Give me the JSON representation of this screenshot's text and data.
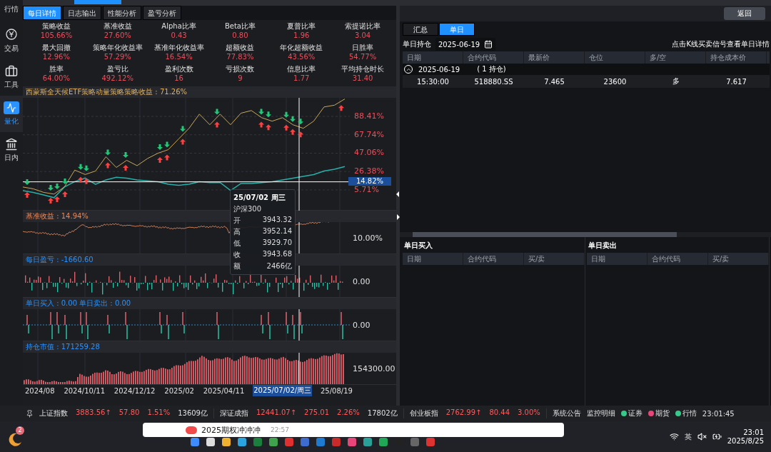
{
  "sidebar": {
    "items": [
      {
        "label": "行情",
        "kind": "cut",
        "selected": false
      },
      {
        "label": "交易",
        "kind": "trade",
        "selected": false
      },
      {
        "label": "工具",
        "kind": "tools",
        "selected": false
      },
      {
        "label": "量化",
        "kind": "quant",
        "selected": true
      },
      {
        "label": "日内",
        "kind": "intraday",
        "selected": false
      }
    ]
  },
  "tabs": [
    {
      "label": "每日详情",
      "selected": true
    },
    {
      "label": "日志输出",
      "selected": false
    },
    {
      "label": "性能分析",
      "selected": false
    },
    {
      "label": "盈亏分析",
      "selected": false
    }
  ],
  "stats": [
    {
      "label": "策略收益",
      "value": "105.66%"
    },
    {
      "label": "基准收益",
      "value": "27.60%"
    },
    {
      "label": "Alpha比率",
      "value": "0.43"
    },
    {
      "label": "Beta比率",
      "value": "0.80"
    },
    {
      "label": "夏普比率",
      "value": "1.96"
    },
    {
      "label": "索提诺比率",
      "value": "3.04"
    },
    {
      "label": "最大回撤",
      "value": "12.96%"
    },
    {
      "label": "策略年化收益率",
      "value": "57.29%"
    },
    {
      "label": "基准年化收益率",
      "value": "16.54%"
    },
    {
      "label": "超额收益",
      "value": "77.83%"
    },
    {
      "label": "年化超额收益",
      "value": "43.56%"
    },
    {
      "label": "日胜率",
      "value": "54.77%"
    },
    {
      "label": "胜率",
      "value": "64.00%"
    },
    {
      "label": "盈亏比",
      "value": "492.12%"
    },
    {
      "label": "盈利次数",
      "value": "16"
    },
    {
      "label": "亏损次数",
      "value": "9"
    },
    {
      "label": "信息比率",
      "value": "1.77"
    },
    {
      "label": "平均持仓时长",
      "value": "31.40"
    }
  ],
  "strategy_chart": {
    "title": "西蒙斯全天候ETF策略动量策略策略收益 : 71.26%",
    "chart_data": {
      "type": "line",
      "grid": true,
      "ref_lines": [
        {
          "axis": "y",
          "value": 14.82,
          "label": "14.82%"
        }
      ],
      "categories": [
        null,
        null,
        null,
        null,
        null,
        null,
        null,
        null,
        null,
        null,
        null,
        null,
        null,
        null,
        null,
        null,
        null,
        null,
        null,
        null,
        null,
        null,
        null,
        null,
        null,
        null,
        null,
        null,
        null,
        null,
        null,
        null
      ],
      "ylim": [
        -17.6,
        109.3
      ],
      "yticks": [
        {
          "value": 88.41,
          "label": "88.41%"
        },
        {
          "value": 67.74,
          "label": "67.74%"
        },
        {
          "value": 47.06,
          "label": "47.06%"
        },
        {
          "value": 26.38,
          "label": "26.38%"
        },
        {
          "value": 5.71,
          "label": "5.71%"
        }
      ],
      "series": [
        {
          "color": "#c9a85a",
          "values": [
            9,
            7,
            3,
            1,
            9,
            28,
            23,
            27,
            43,
            31,
            39,
            33,
            41,
            47,
            51,
            63,
            75,
            91,
            79,
            91,
            79,
            92,
            95,
            87,
            83,
            87,
            79,
            75,
            83,
            99,
            101,
            108
          ]
        },
        {
          "color": "#27b0a8",
          "values": [
            5,
            3,
            0,
            -3,
            9,
            15,
            19,
            12,
            17,
            20,
            19,
            17,
            16,
            15,
            12,
            11,
            12,
            15,
            14,
            14,
            5,
            13,
            13,
            14,
            15,
            17,
            19,
            21,
            23,
            27,
            29,
            32
          ]
        }
      ]
    }
  },
  "tooltip": {
    "date": "25/07/02 周三",
    "name": "沪深300",
    "rows": [
      {
        "label": "开",
        "value": "3943.32"
      },
      {
        "label": "高",
        "value": "3952.14"
      },
      {
        "label": "低",
        "value": "3929.70"
      },
      {
        "label": "收",
        "value": "3943.68"
      },
      {
        "label": "额",
        "value": "2466亿"
      }
    ]
  },
  "panels": [
    {
      "kind": "benchmark",
      "title": "基准收益 : 14.94%",
      "y_label": "10.00%"
    },
    {
      "kind": "pnl",
      "title": "每日盈亏 : -1660.60",
      "y_label": "0.00"
    },
    {
      "kind": "signals",
      "title": "单日买入 : 0.00  单日卖出 : 0.00",
      "y_label": "0.00"
    },
    {
      "kind": "position",
      "title": "持仓市值 : 171259.28",
      "y_label": "154300.00"
    }
  ],
  "x_axis": [
    {
      "label": "2024/08",
      "selected": false
    },
    {
      "label": "2024/10/11",
      "selected": false
    },
    {
      "label": "2024/12/12",
      "selected": false
    },
    {
      "label": "2025/02",
      "selected": false
    },
    {
      "label": "2025/04/11",
      "selected": false
    },
    {
      "label": "2025/07/02/周三",
      "selected": true
    },
    {
      "label": "25/08/19",
      "selected": false
    }
  ],
  "back_button": "返回",
  "right_tabs": [
    {
      "label": "汇总",
      "selected": false
    },
    {
      "label": "单日",
      "selected": true
    }
  ],
  "holding": {
    "label": "单日持仓",
    "date": "2025-06-19",
    "hint": "点击K线买卖信号查看单日详情"
  },
  "holdings_table": {
    "columns": [
      "日期",
      "合约代码",
      "最新价",
      "仓位",
      "多/空",
      "持仓成本价"
    ],
    "groups": [
      {
        "date": "2025-06-19",
        "count": "( 1 持仓)",
        "expanded": true,
        "rows": [
          [
            "15:30:00",
            "518880.SS",
            "7.465",
            "23600",
            "多",
            "7.617"
          ]
        ]
      }
    ]
  },
  "trade_tables": [
    {
      "title": "单日买入",
      "columns": [
        "日期",
        "合约代码",
        "买/卖"
      ]
    },
    {
      "title": "单日卖出",
      "columns": [
        "日期",
        "合约代码",
        "买/卖"
      ]
    }
  ],
  "status_bar": {
    "indices": [
      {
        "name": "上证指数",
        "price": "3883.56↑",
        "change": "57.80",
        "percent": "1.51%",
        "amount": "13609亿"
      },
      {
        "name": "深证成指",
        "price": "12441.07↑",
        "change": "275.01",
        "percent": "2.26%",
        "amount": "17802亿"
      },
      {
        "name": "创业板指",
        "price": "2762.99↑",
        "change": "80.44",
        "percent": "3.00%"
      }
    ],
    "links": [
      "系统公告",
      "监控明细"
    ],
    "indicators": [
      {
        "label": "证券",
        "color": "#35c98a"
      },
      {
        "label": "期货",
        "color": "#e8457a"
      },
      {
        "label": "行情",
        "color": "#35c98a"
      }
    ],
    "time": "23:01:45"
  },
  "taskbar": {
    "weather_badge": "2",
    "notification": {
      "text": "2025期权冲冲冲",
      "time": "22:57"
    },
    "ime": "英",
    "time": "23:01",
    "date": "2025/8/25"
  }
}
